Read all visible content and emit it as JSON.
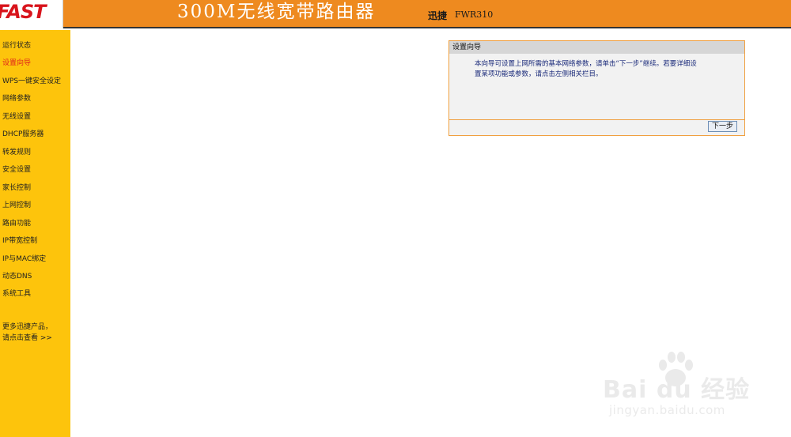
{
  "header": {
    "logo": "FAST",
    "title": "300M无线宽带路由器",
    "brand": "迅捷",
    "model": "FWR310"
  },
  "sidebar": {
    "items": [
      {
        "label": "运行状态"
      },
      {
        "label": "设置向导",
        "active": true
      },
      {
        "label": "WPS一键安全设定"
      },
      {
        "label": "网络参数"
      },
      {
        "label": "无线设置"
      },
      {
        "label": "DHCP服务器"
      },
      {
        "label": "转发规则"
      },
      {
        "label": "安全设置"
      },
      {
        "label": "家长控制"
      },
      {
        "label": "上网控制"
      },
      {
        "label": "路由功能"
      },
      {
        "label": "IP带宽控制"
      },
      {
        "label": "IP与MAC绑定"
      },
      {
        "label": "动态DNS"
      },
      {
        "label": "系统工具"
      }
    ],
    "promo_line1": "更多迅捷产品，",
    "promo_line2": "请点击查看 >>"
  },
  "wizard": {
    "title": "设置向导",
    "line1": "本向导可设置上网所需的基本网络参数，请单击“下一步”继续。若要详细设",
    "line2": "置某项功能或参数，请点击左侧相关栏目。",
    "next_button": "下一步"
  },
  "watermark": {
    "text": "Bai du 经验",
    "url": "jingyan.baidu.com"
  },
  "colors": {
    "header_orange": "#ee8a1f",
    "sidebar_yellow": "#fdc40c",
    "active_red": "#e0241c",
    "panel_border": "#f0a040",
    "body_text_blue": "#1a2a7a"
  }
}
